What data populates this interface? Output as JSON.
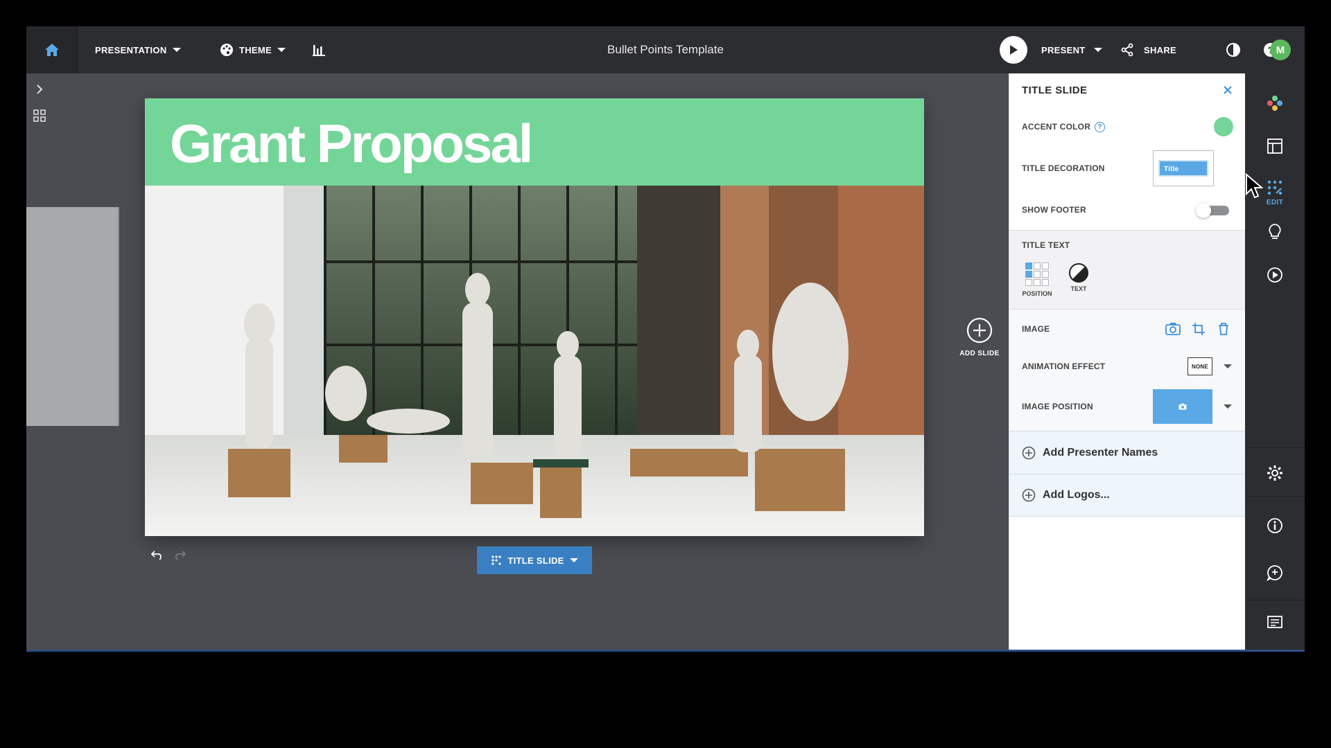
{
  "topbar": {
    "presentation_label": "PRESENTATION",
    "theme_label": "THEME",
    "doc_title": "Bullet Points Template",
    "present_label": "PRESENT",
    "share_label": "SHARE",
    "avatar_initial": "M"
  },
  "slide": {
    "title": "Grant Proposal",
    "accent_color": "#74d598"
  },
  "canvas": {
    "add_slide_label": "ADD SLIDE",
    "layout_button_label": "TITLE SLIDE"
  },
  "panel": {
    "header": "TITLE SLIDE",
    "accent_color_label": "ACCENT COLOR",
    "help_glyph": "?",
    "title_decoration_label": "TITLE DECORATION",
    "title_decoration_preview": "Title",
    "show_footer_label": "SHOW FOOTER",
    "show_footer_on": false,
    "title_text_label": "TITLE TEXT",
    "position_label": "POSITION",
    "text_label": "TEXT",
    "image_label": "IMAGE",
    "animation_effect_label": "ANIMATION EFFECT",
    "animation_effect_value": "NONE",
    "image_position_label": "IMAGE POSITION",
    "add_presenter_names": "Add Presenter Names",
    "add_logos": "Add Logos..."
  },
  "rail": {
    "edit_label": "EDIT"
  },
  "colors": {
    "accent": "#74d598",
    "primary_blue": "#3a7fc1",
    "light_blue": "#5aa9e6",
    "topbar_bg": "#2c2d31",
    "canvas_bg": "#4b4c52"
  }
}
